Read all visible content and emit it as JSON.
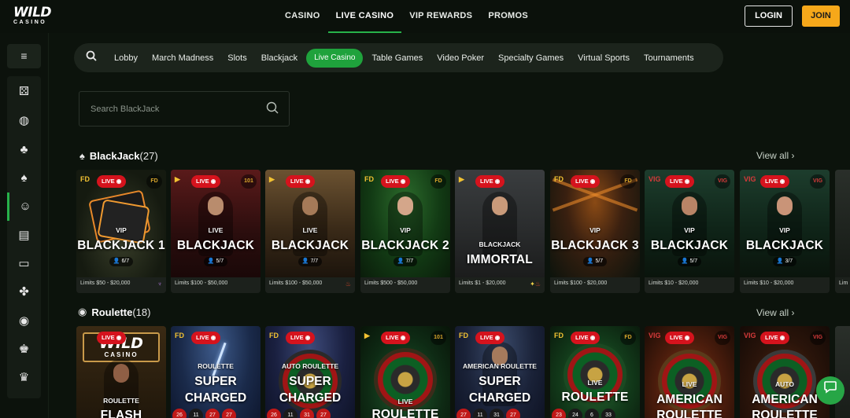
{
  "header": {
    "logo_line1": "WILD",
    "logo_line2": "CASINO",
    "nav": [
      "CASINO",
      "LIVE CASINO",
      "VIP REWARDS",
      "PROMOS"
    ],
    "active_nav": "LIVE CASINO",
    "login_label": "LOGIN",
    "join_label": "JOIN"
  },
  "sidebar": {
    "menu_icon": "≡",
    "items": [
      {
        "icon": "dice-icon",
        "glyph": "⚄"
      },
      {
        "icon": "basketball-icon",
        "glyph": "◍"
      },
      {
        "icon": "cherries-icon",
        "glyph": "♣"
      },
      {
        "icon": "spade-icon",
        "glyph": "♠"
      },
      {
        "icon": "live-dealer-icon",
        "glyph": "☺"
      },
      {
        "icon": "cards-icon",
        "glyph": "▤"
      },
      {
        "icon": "laptop-icon",
        "glyph": "▭"
      },
      {
        "icon": "clover-icon",
        "glyph": "✤"
      },
      {
        "icon": "sports-ball-icon",
        "glyph": "◉"
      },
      {
        "icon": "trophy-icon",
        "glyph": "♚"
      },
      {
        "icon": "crown-icon",
        "glyph": "♛"
      }
    ],
    "active_index": 4
  },
  "categories": {
    "items": [
      "Lobby",
      "March Madness",
      "Slots",
      "Blackjack",
      "Live Casino",
      "Table Games",
      "Video Poker",
      "Specialty Games",
      "Virtual Sports",
      "Tournaments"
    ],
    "active": "Live Casino"
  },
  "search": {
    "placeholder": "Search BlackJack"
  },
  "sections": [
    {
      "title": "BlackJack",
      "count": "(27)",
      "view_all": "View all",
      "cards": [
        {
          "live": "LIVE",
          "sub": "VIP",
          "title": "BLACKJACK 1",
          "seats": "6/7",
          "limits": "Limits $50 - $20,000",
          "prov": "FD",
          "prov2": "FD"
        },
        {
          "live": "LIVE",
          "sub": "LIVE",
          "title": "BLACKJACK",
          "seats": "5/7",
          "limits": "Limits $100 - $50,000",
          "prov": "▶",
          "prov2": "101"
        },
        {
          "live": "LIVE",
          "sub": "LIVE",
          "title": "BLACKJACK",
          "seats": "7/7",
          "limits": "Limits $100 - $50,000",
          "prov": "▶",
          "prov2": ""
        },
        {
          "live": "LIVE",
          "sub": "VIP",
          "title": "BLACKJACK 2",
          "seats": "7/7",
          "limits": "Limits $500 - $50,000",
          "prov": "FD",
          "prov2": "FD"
        },
        {
          "live": "LIVE",
          "sub": "BLACKJACK",
          "title": "IMMORTAL",
          "seats": "",
          "limits": "Limits $1 - $20,000",
          "prov": "▶",
          "prov2": ""
        },
        {
          "live": "LIVE",
          "sub": "VIP",
          "title": "BLACKJACK 3",
          "seats": "5/7",
          "limits": "Limits $100 - $20,000",
          "prov": "FD",
          "prov2": "FD"
        },
        {
          "live": "LIVE",
          "sub": "VIP",
          "title": "BLACKJACK",
          "seats": "5/7",
          "limits": "Limits $10 - $20,000",
          "prov": "VIG",
          "prov2": "VIG"
        },
        {
          "live": "LIVE",
          "sub": "VIP",
          "title": "BLACKJACK",
          "seats": "3/7",
          "limits": "Limits $10 - $20,000",
          "prov": "VIG",
          "prov2": "VIG"
        },
        {
          "live": "",
          "sub": "",
          "title": "",
          "seats": "",
          "limits": "Lim",
          "prov": "",
          "prov2": ""
        }
      ]
    },
    {
      "title": "Roulette",
      "count": "(18)",
      "view_all": "View all",
      "cards": [
        {
          "live": "LIVE",
          "sub": "ROULETTE",
          "title": "FLASH",
          "logo1": "WILD",
          "logo2": "CASINO"
        },
        {
          "live": "LIVE",
          "sub": "ROULETTE",
          "title": "SUPER",
          "title2": "CHARGED",
          "prov": "FD",
          "nums": [
            "26",
            "11",
            "27",
            "27"
          ]
        },
        {
          "live": "LIVE",
          "sub": "AUTO ROULETTE",
          "title": "SUPER",
          "title2": "CHARGED",
          "prov": "FD",
          "nums": [
            "26",
            "11",
            "31",
            "27"
          ]
        },
        {
          "live": "LIVE",
          "sub": "LIVE",
          "title": "ROULETTE",
          "prov": "▶",
          "prov2": "101"
        },
        {
          "live": "LIVE",
          "sub": "AMERICAN ROULETTE",
          "title": "SUPER",
          "title2": "CHARGED",
          "prov": "FD",
          "nums": [
            "27",
            "11",
            "31",
            "27"
          ]
        },
        {
          "live": "LIVE",
          "sub": "LIVE",
          "title": "ROULETTE",
          "prov": "FD",
          "prov2": "FD",
          "nums": [
            "23",
            "24",
            "6",
            "33"
          ]
        },
        {
          "live": "LIVE",
          "sub": "LIVE",
          "title": "AMERICAN",
          "title2": "ROULETTE",
          "prov": "VIG",
          "prov2": "VIG"
        },
        {
          "live": "LIVE",
          "sub": "AUTO",
          "title": "AMERICAN",
          "title2": "ROULETTE",
          "prov": "VIG",
          "prov2": "VIG"
        },
        {
          "live": "",
          "sub": "",
          "title": ""
        }
      ]
    }
  ],
  "chat_icon": "chat-bubble-icon"
}
